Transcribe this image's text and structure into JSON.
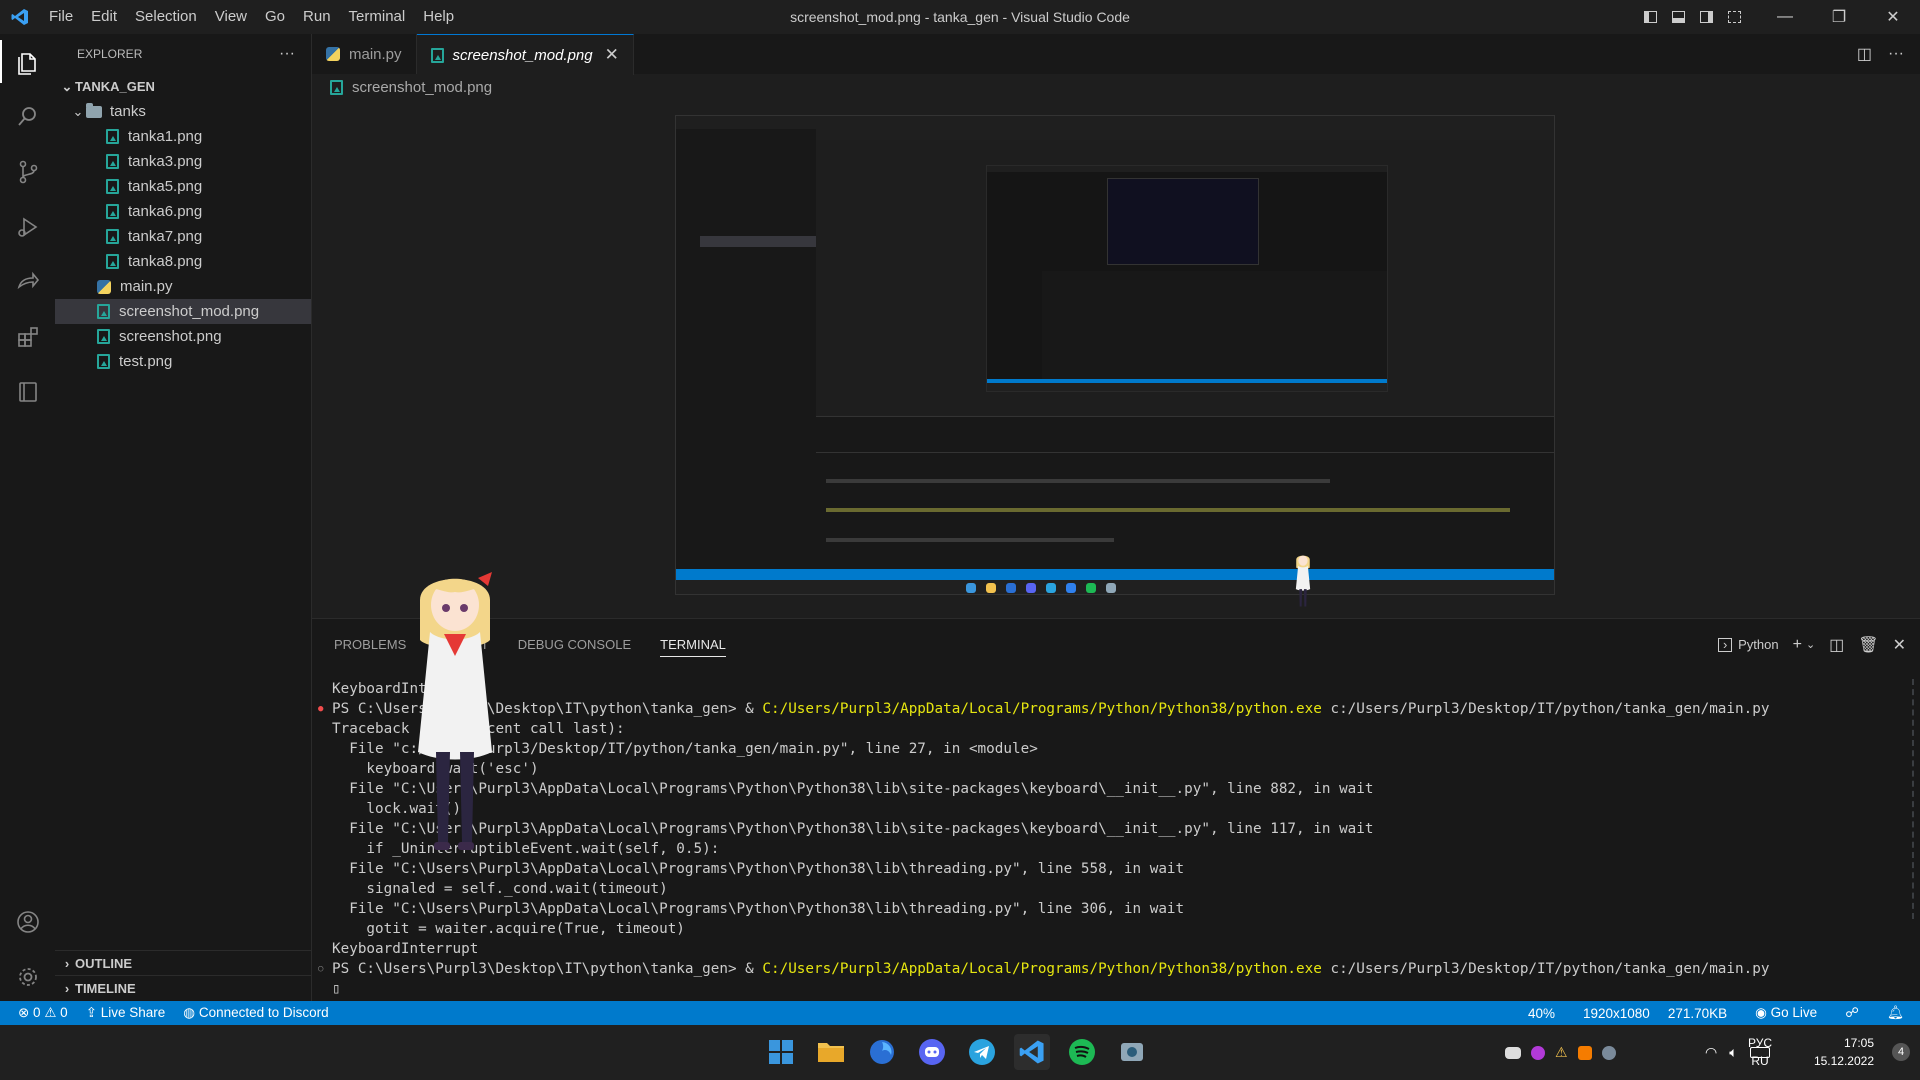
{
  "titlebar": {
    "menu": [
      "File",
      "Edit",
      "Selection",
      "View",
      "Go",
      "Run",
      "Terminal",
      "Help"
    ],
    "title": "screenshot_mod.png - tanka_gen - Visual Studio Code"
  },
  "sidebar": {
    "header": "EXPLORER",
    "root": "TANKA_GEN",
    "folder": "tanks",
    "tanks_files": [
      "tanka1.png",
      "tanka3.png",
      "tanka5.png",
      "tanka6.png",
      "tanka7.png",
      "tanka8.png"
    ],
    "files": [
      "main.py",
      "screenshot_mod.png",
      "screenshot.png",
      "test.png"
    ],
    "outline": "OUTLINE",
    "timeline": "TIMELINE"
  },
  "tabs": {
    "tab1": "main.py",
    "tab2": "screenshot_mod.png"
  },
  "breadcrumb": "screenshot_mod.png",
  "panel": {
    "tabs": [
      "PROBLEMS",
      "OUTPUT",
      "DEBUG CONSOLE",
      "TERMINAL"
    ],
    "shell": "Python"
  },
  "terminal": {
    "l1": "KeyboardInterrupt",
    "l2_prompt": "PS C:\\Users\\Purpl3\\Desktop\\IT\\python\\tanka_gen> & ",
    "l2_exe": "C:/Users/Purpl3/AppData/Local/Programs/Python/Python38/python.exe",
    "l2_arg": " c:/Users/Purpl3/Desktop/IT/python/tanka_gen/main.py",
    "l3": "Traceback (most recent call last):",
    "l4": "  File \"c:/Users/Purpl3/Desktop/IT/python/tanka_gen/main.py\", line 27, in <module>",
    "l5": "    keyboard.wait('esc')",
    "l6": "  File \"C:\\Users\\Purpl3\\AppData\\Local\\Programs\\Python\\Python38\\lib\\site-packages\\keyboard\\__init__.py\", line 882, in wait",
    "l7": "    lock.wait()",
    "l8": "  File \"C:\\Users\\Purpl3\\AppData\\Local\\Programs\\Python\\Python38\\lib\\site-packages\\keyboard\\__init__.py\", line 117, in wait",
    "l9": "    if _UninterruptibleEvent.wait(self, 0.5):",
    "l10": "  File \"C:\\Users\\Purpl3\\AppData\\Local\\Programs\\Python\\Python38\\lib\\threading.py\", line 558, in wait",
    "l11": "    signaled = self._cond.wait(timeout)",
    "l12": "  File \"C:\\Users\\Purpl3\\AppData\\Local\\Programs\\Python\\Python38\\lib\\threading.py\", line 306, in wait",
    "l13": "    gotit = waiter.acquire(True, timeout)",
    "l14": "KeyboardInterrupt",
    "cursor": "▯"
  },
  "statusbar": {
    "problems": "⊗ 0 ⚠ 0",
    "liveshare": "Live Share",
    "discord": "Connected to Discord",
    "zoom": "40%",
    "dims": "1920x1080",
    "size": "271.70KB",
    "golive": "Go Live"
  },
  "taskbar": {
    "lang1": "РУС",
    "lang2": "RU",
    "time": "17:05",
    "date": "15.12.2022",
    "badge": "4"
  },
  "colors": {
    "accent": "#007acc",
    "terminal_yellow": "#e5e510",
    "image_icon": "#26a69a"
  }
}
